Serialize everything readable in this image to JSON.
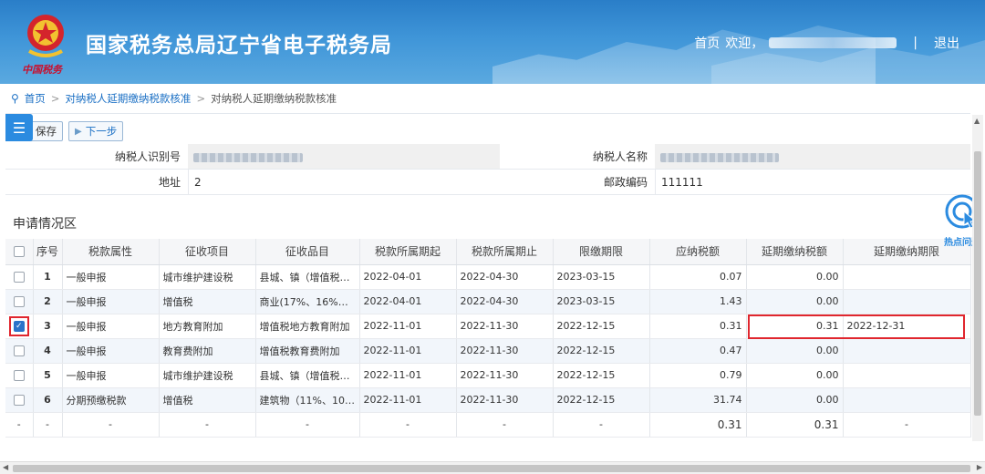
{
  "header": {
    "site_title": "国家税务总局辽宁省电子税务局",
    "emblem_caption": "中国税务",
    "nav_home": "首页",
    "nav_welcome": "欢迎，",
    "nav_separator": "|",
    "nav_logout": "退出"
  },
  "breadcrumb": {
    "home": "首页",
    "level1": "对纳税人延期缴纳税款核准",
    "level2": "对纳税人延期缴纳税款核准",
    "separator": ">"
  },
  "toolbar": {
    "menu_icon": "☰",
    "save_label": "保存",
    "next_label": "下一步"
  },
  "info": {
    "taxpayer_id_label": "纳税人识别号",
    "taxpayer_name_label": "纳税人名称",
    "address_label": "地址",
    "address_value": "2",
    "postcode_label": "邮政编码",
    "postcode_value": "111111"
  },
  "section": {
    "title": "申请情况区"
  },
  "table": {
    "headers": [
      "序号",
      "税款属性",
      "征收项目",
      "征收品目",
      "税款所属期起",
      "税款所属期止",
      "限缴期限",
      "应纳税额",
      "延期缴纳税额",
      "延期缴纳期限"
    ],
    "rows": [
      {
        "no": "1",
        "attr": "一般申报",
        "item": "城市维护建设税",
        "sub": "县城、镇（增值税附…",
        "start": "2022-04-01",
        "end": "2022-04-30",
        "limit": "2023-03-15",
        "due": "0.07",
        "defer": "0.00",
        "defer_date": "",
        "checked": false
      },
      {
        "no": "2",
        "attr": "一般申报",
        "item": "增值税",
        "sub": "商业(17%、16%、13…",
        "start": "2022-04-01",
        "end": "2022-04-30",
        "limit": "2023-03-15",
        "due": "1.43",
        "defer": "0.00",
        "defer_date": "",
        "checked": false
      },
      {
        "no": "3",
        "attr": "一般申报",
        "item": "地方教育附加",
        "sub": "增值税地方教育附加",
        "start": "2022-11-01",
        "end": "2022-11-30",
        "limit": "2022-12-15",
        "due": "0.31",
        "defer": "0.31",
        "defer_date": "2022-12-31",
        "checked": true
      },
      {
        "no": "4",
        "attr": "一般申报",
        "item": "教育费附加",
        "sub": "增值税教育费附加",
        "start": "2022-11-01",
        "end": "2022-11-30",
        "limit": "2022-12-15",
        "due": "0.47",
        "defer": "0.00",
        "defer_date": "",
        "checked": false
      },
      {
        "no": "5",
        "attr": "一般申报",
        "item": "城市维护建设税",
        "sub": "县城、镇（增值税附…",
        "start": "2022-11-01",
        "end": "2022-11-30",
        "limit": "2022-12-15",
        "due": "0.79",
        "defer": "0.00",
        "defer_date": "",
        "checked": false
      },
      {
        "no": "6",
        "attr": "分期预缴税款",
        "item": "增值税",
        "sub": "建筑物（11%、10%…",
        "start": "2022-11-01",
        "end": "2022-11-30",
        "limit": "2022-12-15",
        "due": "31.74",
        "defer": "0.00",
        "defer_date": "",
        "checked": false
      }
    ],
    "total_row": {
      "dash": "-",
      "due_total": "0.31",
      "defer_total": "0.31"
    }
  },
  "float": {
    "hot_label": "热点问题"
  },
  "colors": {
    "header_blue": "#2a7ec8",
    "accent": "#2b8be0",
    "highlight_red": "#e0262e"
  }
}
